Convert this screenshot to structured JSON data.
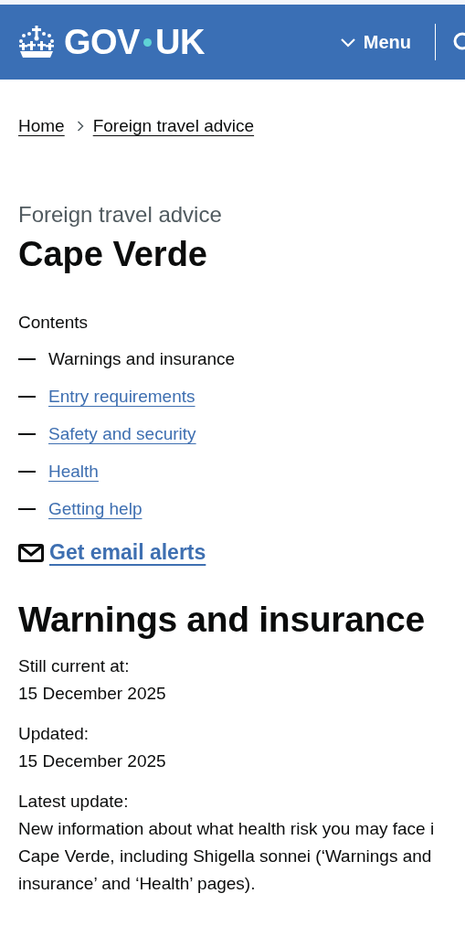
{
  "header": {
    "logo": {
      "left": "GOV",
      "right": "UK"
    },
    "menu_button": "Menu"
  },
  "breadcrumbs": [
    {
      "label": "Home"
    },
    {
      "label": "Foreign travel advice"
    }
  ],
  "caption": "Foreign travel advice",
  "title": "Cape Verde",
  "contents": {
    "heading": "Contents",
    "items": [
      {
        "label": "Warnings and insurance",
        "selected": true
      },
      {
        "label": "Entry requirements",
        "selected": false
      },
      {
        "label": "Safety and security",
        "selected": false
      },
      {
        "label": "Health",
        "selected": false
      },
      {
        "label": "Getting help",
        "selected": false
      }
    ]
  },
  "email_alerts": "Get email alerts",
  "section_title": "Warnings and insurance",
  "metadata": [
    {
      "label": "Still current at:",
      "value": [
        "15 December 2025"
      ]
    },
    {
      "label": "Updated:",
      "value": [
        "15 December 2025"
      ]
    },
    {
      "label": "Latest update:",
      "value": [
        "New information about what health risk you may face i",
        "Cape Verde, including Shigella sonnei (‘Warnings and",
        "insurance’ and ‘Health’ pages)."
      ]
    }
  ]
}
